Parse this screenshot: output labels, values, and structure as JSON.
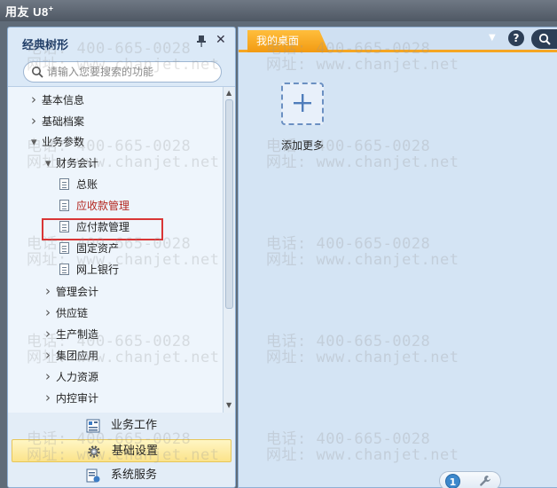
{
  "app": {
    "title": "用友 U8",
    "title_sup": "+"
  },
  "tree_panel": {
    "title": "经典树形",
    "search_placeholder": "请输入您要搜索的功能",
    "items": [
      {
        "label": "基本信息",
        "level": 0,
        "kind": "collapsed"
      },
      {
        "label": "基础档案",
        "level": 0,
        "kind": "collapsed"
      },
      {
        "label": "业务参数",
        "level": 0,
        "kind": "expanded"
      },
      {
        "label": "财务会计",
        "level": 1,
        "kind": "expanded"
      },
      {
        "label": "总账",
        "level": 2,
        "kind": "leaf"
      },
      {
        "label": "应收款管理",
        "level": 2,
        "kind": "leaf",
        "highlighted": true
      },
      {
        "label": "应付款管理",
        "level": 2,
        "kind": "leaf"
      },
      {
        "label": "固定资产",
        "level": 2,
        "kind": "leaf"
      },
      {
        "label": "网上银行",
        "level": 2,
        "kind": "leaf"
      },
      {
        "label": "管理会计",
        "level": 1,
        "kind": "collapsed"
      },
      {
        "label": "供应链",
        "level": 1,
        "kind": "collapsed"
      },
      {
        "label": "生产制造",
        "level": 1,
        "kind": "collapsed"
      },
      {
        "label": "集团应用",
        "level": 1,
        "kind": "collapsed"
      },
      {
        "label": "人力资源",
        "level": 1,
        "kind": "collapsed"
      },
      {
        "label": "内控审计",
        "level": 1,
        "kind": "collapsed"
      }
    ],
    "nav": [
      {
        "label": "业务工作",
        "icon": "business-work-icon",
        "selected": false
      },
      {
        "label": "基础设置",
        "icon": "gear-icon",
        "selected": true
      },
      {
        "label": "系统服务",
        "icon": "system-service-icon",
        "selected": false
      }
    ]
  },
  "desktop": {
    "tab_label": "我的桌面",
    "add_label": "添加更多",
    "page_number": "1"
  },
  "watermark": {
    "phone": "电话: 400-665-0028",
    "site": "网址: www.chanjet.net"
  },
  "colors": {
    "accent_orange": "#f5a623",
    "highlight_red": "#d93636",
    "selected_yellow": "#fbe38a"
  }
}
